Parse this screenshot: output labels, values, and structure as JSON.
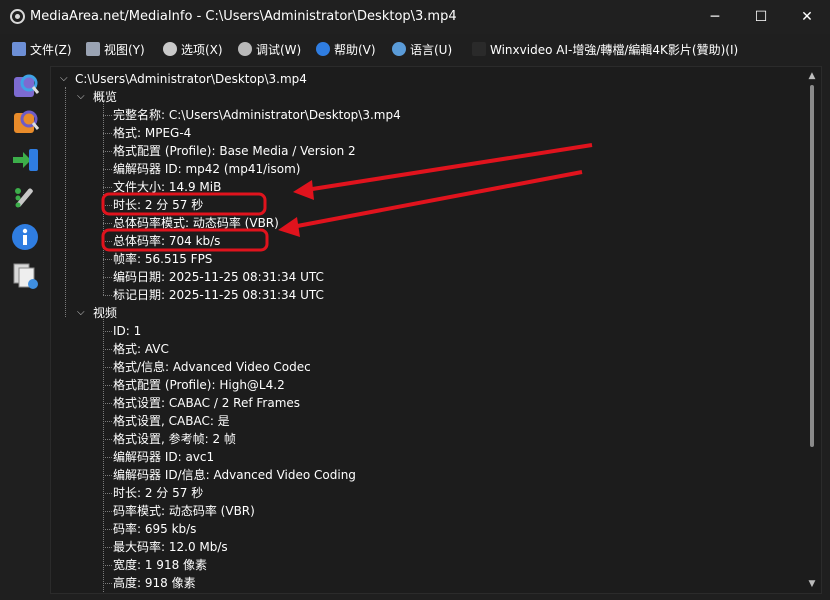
{
  "window": {
    "title": "MediaArea.net/MediaInfo - C:\\Users\\Administrator\\Desktop\\3.mp4",
    "min_glyph": "─",
    "max_glyph": "☐",
    "close_glyph": "✕"
  },
  "menu": [
    {
      "label": "文件(Z)",
      "icon": "file-menu-icon",
      "color": "#6d8fd6"
    },
    {
      "label": "视图(Y)",
      "icon": "view-menu-icon",
      "color": "#9aa3b3"
    },
    {
      "label": "选项(X)",
      "icon": "options-menu-icon",
      "color": "#c9c9c9"
    },
    {
      "label": "调试(W)",
      "icon": "debug-menu-icon",
      "color": "#b9b9b9"
    },
    {
      "label": "帮助(V)",
      "icon": "help-menu-icon",
      "color": "#2f7de1"
    },
    {
      "label": "语言(U)",
      "icon": "language-menu-icon",
      "color": "#5a9bd8"
    },
    {
      "label": "Winxvideo AI-增強/轉檔/編輯4K影片(贊助)(I)",
      "icon": "sponsor-menu-icon",
      "color": "#2a2a2a"
    }
  ],
  "sidebar": [
    {
      "name": "open-file-icon"
    },
    {
      "name": "open-folder-icon"
    },
    {
      "name": "export-icon"
    },
    {
      "name": "preferences-icon"
    },
    {
      "name": "about-icon"
    },
    {
      "name": "views-icon"
    }
  ],
  "tree": {
    "root": "C:\\Users\\Administrator\\Desktop\\3.mp4",
    "general": {
      "label": "概览",
      "items": [
        "完整名称: C:\\Users\\Administrator\\Desktop\\3.mp4",
        "格式: MPEG-4",
        "格式配置 (Profile): Base Media / Version 2",
        "编解码器 ID: mp42 (mp41/isom)",
        "文件大小: 14.9 MiB",
        "时长: 2 分 57 秒",
        "总体码率模式: 动态码率 (VBR)",
        "总体码率: 704 kb/s",
        "帧率: 56.515 FPS",
        "编码日期: 2025-11-25 08:31:34 UTC",
        "标记日期: 2025-11-25 08:31:34 UTC"
      ]
    },
    "video": {
      "label": "视频",
      "items": [
        "ID: 1",
        "格式: AVC",
        "格式/信息: Advanced Video Codec",
        "格式配置 (Profile): High@L4.2",
        "格式设置: CABAC / 2 Ref Frames",
        "格式设置, CABAC: 是",
        "格式设置, 参考帧: 2 帧",
        "编解码器 ID: avc1",
        "编解码器 ID/信息: Advanced Video Coding",
        "时长: 2 分 57 秒",
        "码率模式: 动态码率 (VBR)",
        "码率: 695 kb/s",
        "最大码率: 12.0 Mb/s",
        "宽度: 1 918 像素",
        "高度: 918 像素"
      ]
    }
  },
  "scrollbar": {
    "up_glyph": "▲",
    "down_glyph": "▼"
  },
  "annotation_color": "#e0131d"
}
